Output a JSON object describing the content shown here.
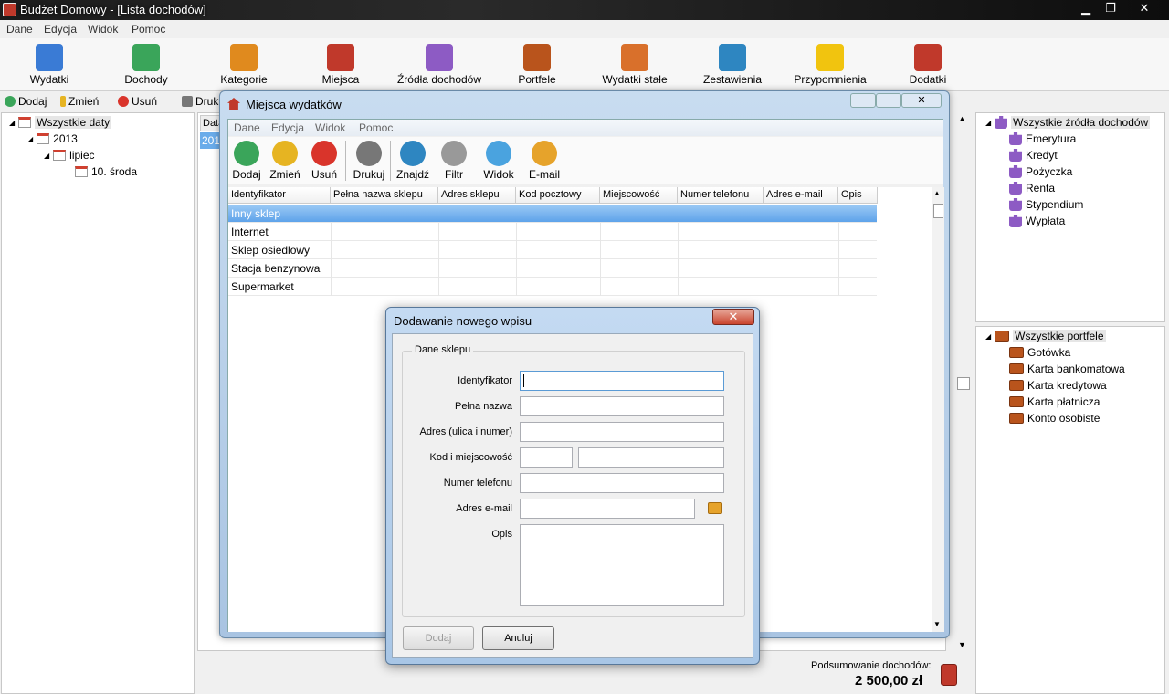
{
  "window": {
    "title": "Budżet Domowy - [Lista dochodów]",
    "min": "▁",
    "max": "❐",
    "close": "✕"
  },
  "menu": [
    "Dane",
    "Edycja",
    "Widok",
    "Pomoc"
  ],
  "ribbon": [
    {
      "label": "Wydatki",
      "icon": "expenses-icon",
      "color": "#3a7bd5"
    },
    {
      "label": "Dochody",
      "icon": "income-icon",
      "color": "#3aa55a"
    },
    {
      "label": "Kategorie",
      "icon": "cart-icon",
      "color": "#e08a1e"
    },
    {
      "label": "Miejsca",
      "icon": "house-icon",
      "color": "#c0392b"
    },
    {
      "label": "Źródła dochodów",
      "icon": "puzzle-icon",
      "color": "#8d5bc4"
    },
    {
      "label": "Portfele",
      "icon": "wallet-icon",
      "color": "#b9541c"
    },
    {
      "label": "Wydatki stałe",
      "icon": "alarm-clock-icon",
      "color": "#d9702b"
    },
    {
      "label": "Zestawienia",
      "icon": "bar-chart-icon",
      "color": "#2e86c1"
    },
    {
      "label": "Przypomnienia",
      "icon": "lightbulb-icon",
      "color": "#f1c40f"
    },
    {
      "label": "Dodatki",
      "icon": "toolbox-icon",
      "color": "#c0392b"
    }
  ],
  "subtoolbar": {
    "add": "Dodaj",
    "edit": "Zmień",
    "delete": "Usuń",
    "print": "Druk"
  },
  "left_tree": {
    "root": "Wszystkie daty",
    "year": "2013",
    "month": "lipiec",
    "day": "10. środa"
  },
  "center_grid": {
    "header": "Data",
    "cell": "201"
  },
  "summary": {
    "label": "Podsumowanie dochodów:",
    "value": "2 500,00  zł"
  },
  "right_top": {
    "root": "Wszystkie źródła dochodów",
    "items": [
      "Emerytura",
      "Kredyt",
      "Pożyczka",
      "Renta",
      "Stypendium",
      "Wypłata"
    ]
  },
  "right_bottom": {
    "root": "Wszystkie portfele",
    "items": [
      "Gotówka",
      "Karta bankomatowa",
      "Karta kredytowa",
      "Karta płatnicza",
      "Konto osobiste"
    ]
  },
  "miejsca": {
    "title": "Miejsca wydatków",
    "menu": [
      "Dane",
      "Edycja",
      "Widok",
      "Pomoc"
    ],
    "toolbar": [
      {
        "label": "Dodaj",
        "icon": "add-icon",
        "color": "#3aa55a"
      },
      {
        "label": "Zmień",
        "icon": "pencil-icon",
        "color": "#e6b422"
      },
      {
        "label": "Usuń",
        "icon": "delete-icon",
        "color": "#d9342b"
      },
      {
        "label": "Drukuj",
        "icon": "printer-icon",
        "color": "#777777"
      },
      {
        "label": "Znajdź",
        "icon": "magnifier-icon",
        "color": "#2e86c1"
      },
      {
        "label": "Filtr",
        "icon": "filter-icon",
        "color": "#999999"
      },
      {
        "label": "Widok",
        "icon": "view-icon",
        "color": "#4aa3df"
      },
      {
        "label": "E-mail",
        "icon": "email-icon",
        "color": "#e6a32b"
      }
    ],
    "columns": [
      "Identyfikator",
      "Pełna nazwa sklepu",
      "Adres sklepu",
      "Kod pocztowy",
      "Miejscowość",
      "Numer telefonu",
      "Adres e-mail",
      "Opis"
    ],
    "rows": [
      "Inny sklep",
      "Internet",
      "Sklep osiedlowy",
      "Stacja benzynowa",
      "Supermarket"
    ]
  },
  "dialog": {
    "title": "Dodawanie nowego wpisu",
    "close": "✕",
    "group": "Dane sklepu",
    "labels": {
      "id": "Identyfikator",
      "name": "Pełna nazwa",
      "address": "Adres (ulica i numer)",
      "code_city": "Kod i miejscowość",
      "phone": "Numer telefonu",
      "email": "Adres e-mail",
      "notes": "Opis"
    },
    "ok": "Dodaj",
    "cancel": "Anuluj"
  }
}
